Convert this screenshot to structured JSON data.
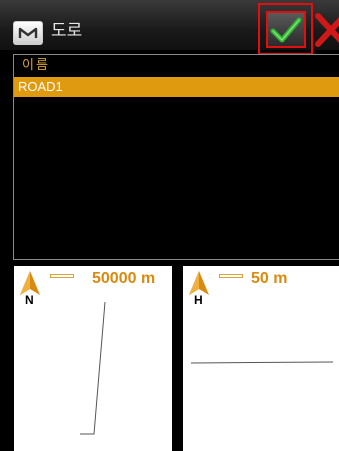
{
  "header": {
    "title": "도로",
    "menu_icon": "m-menu-icon",
    "ok_icon": "checkmark-icon",
    "close_icon": "close-x-icon"
  },
  "list": {
    "header": "이름",
    "items": [
      "ROAD1"
    ],
    "selected_index": 0
  },
  "previews": [
    {
      "orientation_letter": "N",
      "scale": "50000 m"
    },
    {
      "orientation_letter": "H",
      "scale": "50 m"
    }
  ],
  "colors": {
    "accent": "#e09a10",
    "header_text": "#d9a23a",
    "highlight_border": "#e01010",
    "check": "#2fb52f"
  }
}
